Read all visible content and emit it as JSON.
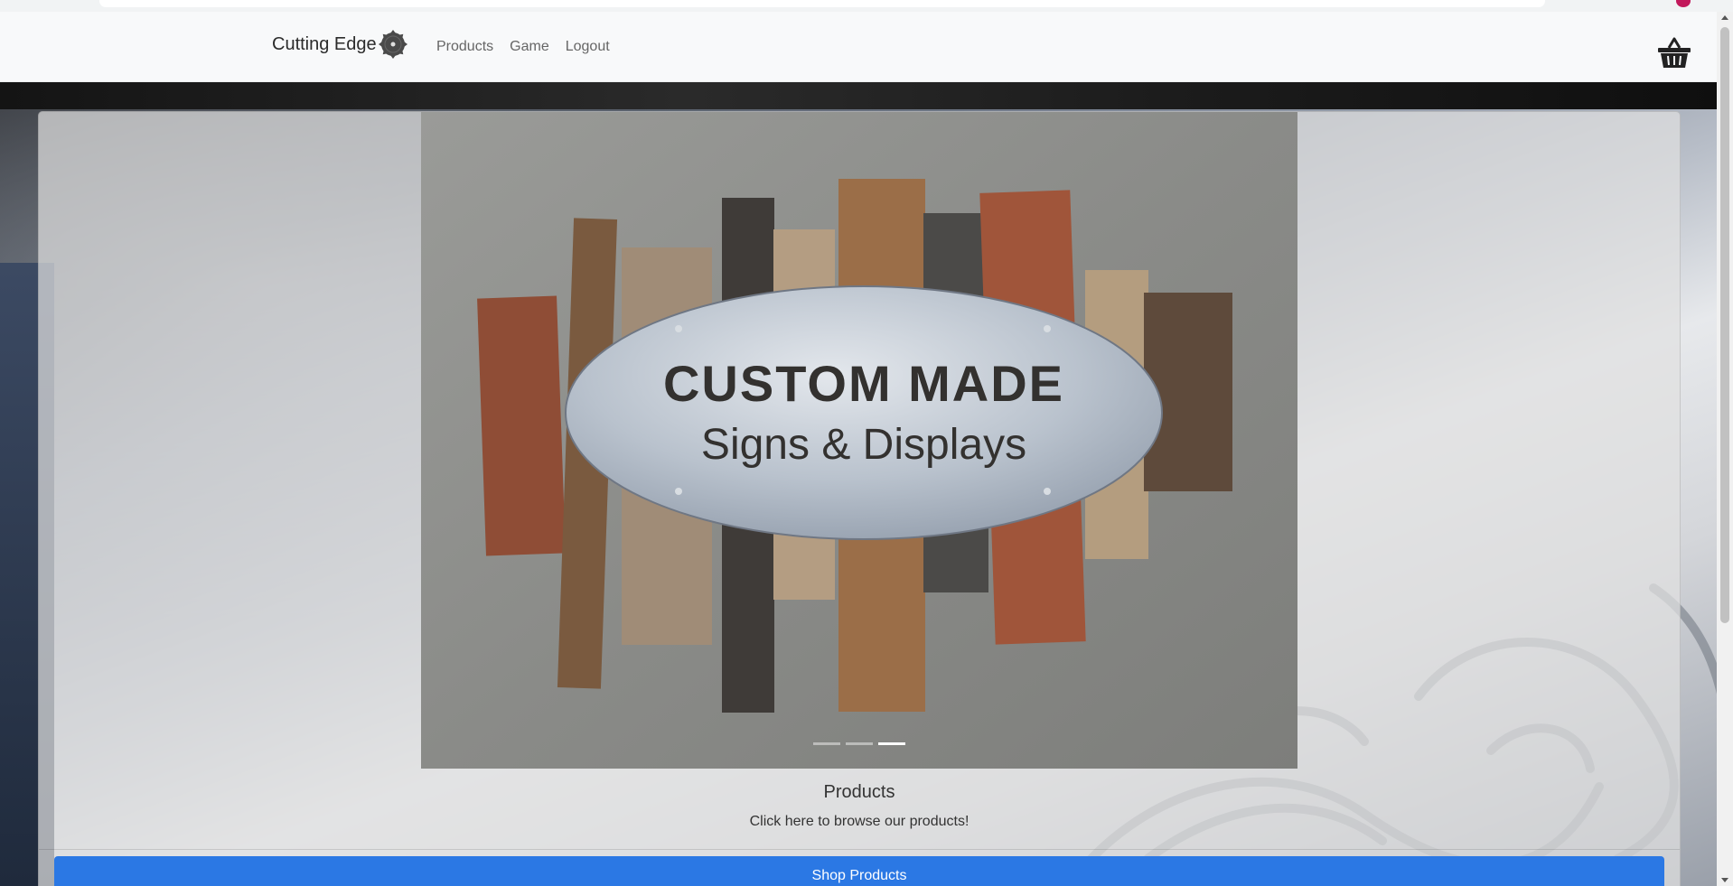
{
  "navbar": {
    "brand": "Cutting Edge",
    "links": [
      "Products",
      "Game",
      "Logout"
    ]
  },
  "carousel": {
    "slide_heading": "CUSTOM MADE",
    "slide_subheading": "Signs & Displays",
    "slide_count": 3,
    "active_slide": 3
  },
  "card": {
    "title": "Products",
    "text": "Click here to browse our products!",
    "button_label": "Shop Products"
  },
  "colors": {
    "primary_button": "#2b78e4",
    "navbar_bg": "#f8f9fa"
  },
  "icons": {
    "brand": "saw-blade-icon",
    "cart": "basket-icon"
  }
}
